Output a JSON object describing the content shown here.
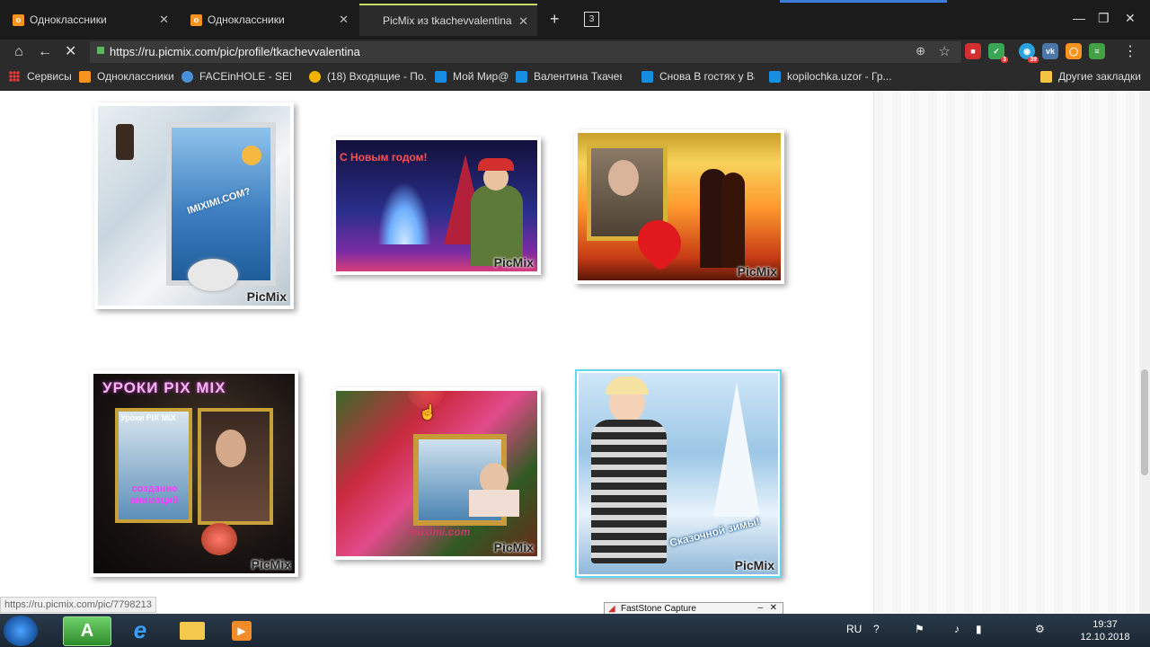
{
  "browser": {
    "tabs": [
      {
        "title": "Одноклассники",
        "active": false
      },
      {
        "title": "Одноклассники",
        "active": false
      },
      {
        "title": "PicMix из tkachevvalentina",
        "active": true
      }
    ],
    "tab_count": "3",
    "url": "https://ru.picmix.com/pic/profile/tkachevvalentina",
    "extension_badges": {
      "shield": "3",
      "chat": "39"
    },
    "bookmarks": [
      {
        "label": "Сервисы",
        "color": "#e53935"
      },
      {
        "label": "Одноклассники",
        "color": "#f7931e"
      },
      {
        "label": "FACEinHOLE - SELE...",
        "color": "#4a90d9"
      },
      {
        "label": "(18) Входящие - По...",
        "color": "#f0b400"
      },
      {
        "label": "Мой Мир@",
        "color": "#168de2"
      },
      {
        "label": "Валентина Ткачева",
        "color": "#168de2"
      },
      {
        "label": "Снова В гостях у Ва...",
        "color": "#168de2"
      },
      {
        "label": "kopilochka.uzor - Гр...",
        "color": "#168de2"
      }
    ],
    "other_bookmarks": "Другие закладки",
    "status_url": "https://ru.picmix.com/pic/7798213"
  },
  "gallery": {
    "watermark": "PicMix",
    "images": [
      {
        "name": "winter-lamp-seal",
        "caption": "IMIXIMI.COM?"
      },
      {
        "name": "new-year-fountain",
        "caption": "С Новым годом!"
      },
      {
        "name": "couple-sunset-heart",
        "caption": ""
      },
      {
        "name": "picmix-lessons",
        "caption": "УРОКИ PIX MIX",
        "caption2": "Уроки PIX MIX",
        "caption3": "создание анимаций"
      },
      {
        "name": "flowers-frame-sea",
        "caption": "imiximi.com"
      },
      {
        "name": "winter-fur-coat",
        "caption": "Сказочной зимы!"
      }
    ]
  },
  "faststone": {
    "title": "FastStone Capture"
  },
  "taskbar": {
    "language": "RU",
    "time": "19:37",
    "date": "12.10.2018"
  }
}
